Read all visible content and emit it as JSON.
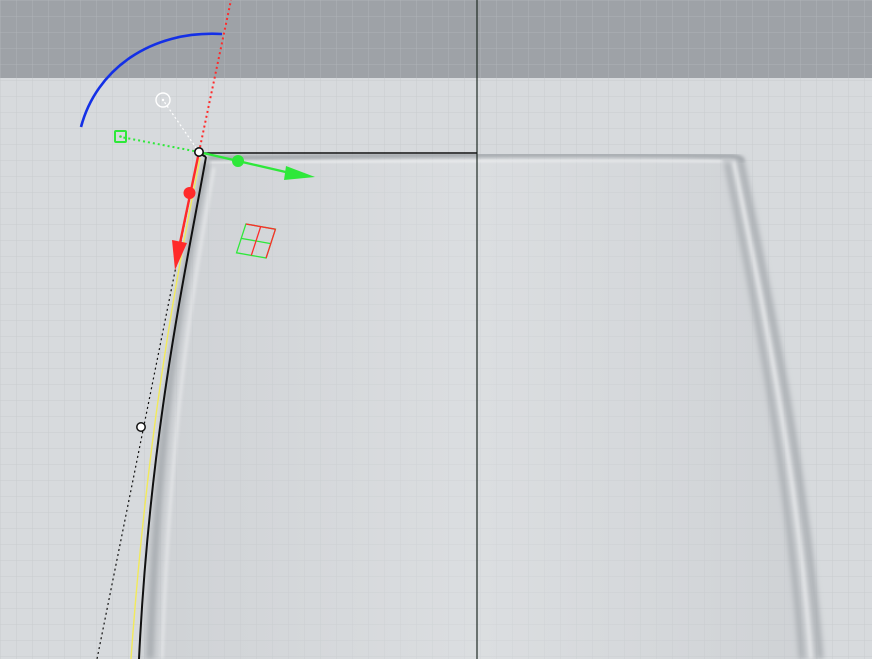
{
  "viewport": {
    "name": "3d-perspective-viewport",
    "colors": {
      "background": "#d7dadd",
      "top_band": "#9ea2a7",
      "grid_minor": "#c9ccd0",
      "grid_major": "#bcc0c4",
      "axis_line": "#1f2a24",
      "curve": "#111111",
      "guide_yellow": "#f2ea5a",
      "glass_edge": "#a6aaaf",
      "glass_highlight": "#f4f5f6"
    }
  },
  "gumball": {
    "rotation_arc_color": "#1430e6",
    "x_axis_color": "#ff2a2a",
    "y_axis_color": "#2ee83a",
    "scale_handle_color": "#2ee83a",
    "center_point_color": "#ffffff",
    "planar_handle_colors": [
      "#2ee83a",
      "#ff2a2a"
    ]
  },
  "control_points": {
    "color": "#ffffff",
    "count": 2
  }
}
